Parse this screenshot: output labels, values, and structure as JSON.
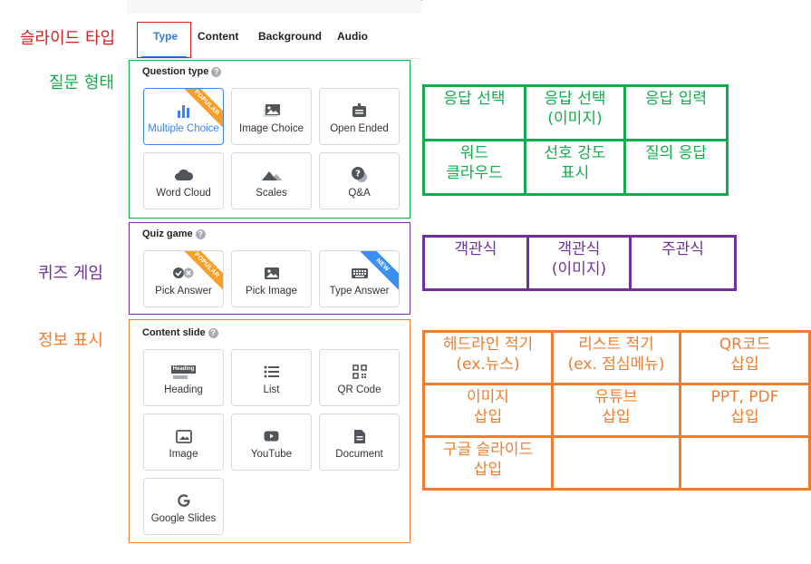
{
  "tabs": [
    {
      "label": "Type",
      "active": true
    },
    {
      "label": "Content",
      "active": false
    },
    {
      "label": "Background",
      "active": false
    },
    {
      "label": "Audio",
      "active": false
    }
  ],
  "annotations": {
    "slide_type": "슬라이드 타입",
    "question_form": "질문 형태",
    "quiz_game": "퀴즈 게임",
    "info_display": "정보 표시"
  },
  "sections": {
    "question_type": {
      "title": "Question type",
      "items": [
        {
          "label": "Multiple Choice",
          "icon": "bar-chart-icon",
          "badge": "POPULAR",
          "selected": true
        },
        {
          "label": "Image Choice",
          "icon": "image-icon"
        },
        {
          "label": "Open Ended",
          "icon": "open-ended-icon"
        },
        {
          "label": "Word Cloud",
          "icon": "cloud-icon"
        },
        {
          "label": "Scales",
          "icon": "mountain-icon"
        },
        {
          "label": "Q&A",
          "icon": "question-bubble-icon"
        }
      ]
    },
    "quiz_game": {
      "title": "Quiz game",
      "items": [
        {
          "label": "Pick Answer",
          "icon": "check-cross-icon",
          "badge": "POPULAR"
        },
        {
          "label": "Pick Image",
          "icon": "image-icon"
        },
        {
          "label": "Type Answer",
          "icon": "keyboard-icon",
          "badge": "NEW"
        }
      ]
    },
    "content_slide": {
      "title": "Content slide",
      "items": [
        {
          "label": "Heading",
          "icon": "heading-icon",
          "icon_text": "Heading"
        },
        {
          "label": "List",
          "icon": "list-icon"
        },
        {
          "label": "QR Code",
          "icon": "qr-code-icon"
        },
        {
          "label": "Image",
          "icon": "image-frame-icon"
        },
        {
          "label": "YouTube",
          "icon": "youtube-icon"
        },
        {
          "label": "Document",
          "icon": "document-icon"
        },
        {
          "label": "Google Slides",
          "icon": "google-icon"
        }
      ]
    }
  },
  "tables": {
    "question": [
      [
        "응답 선택",
        "응답 선택\n(이미지)",
        "응답 입력"
      ],
      [
        "워드\n클라우드",
        "선호 강도\n표시",
        "질의 응답"
      ]
    ],
    "quiz": [
      [
        "객관식",
        "객관식\n(이미지)",
        "주관식"
      ]
    ],
    "content": [
      [
        "헤드라인 적기\n(ex.뉴스)",
        "리스트 적기\n(ex. 점심메뉴)",
        "QR코드\n삽입"
      ],
      [
        "이미지\n삽입",
        "유튜브\n삽입",
        "PPT, PDF\n삽입"
      ],
      [
        "구글 슬라이드\n삽입",
        "",
        ""
      ]
    ]
  },
  "colors": {
    "accent_blue": "#2f7de1",
    "tab_highlight": "#d62020",
    "green": "#13ac4c",
    "purple": "#7030a0",
    "orange": "#ed7d31"
  }
}
